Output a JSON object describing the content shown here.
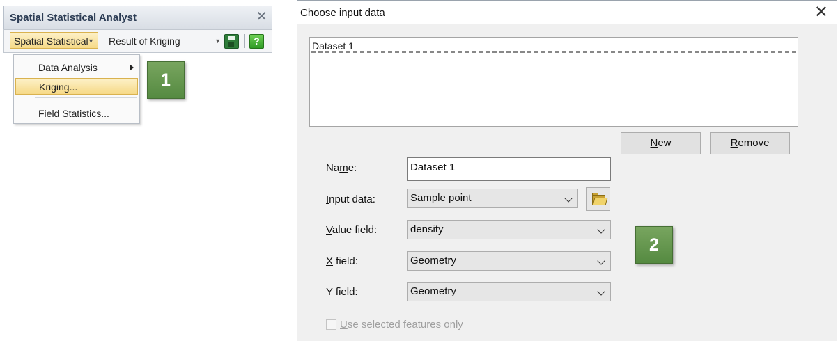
{
  "panel": {
    "title": "Spatial Statistical Analyst",
    "close_glyph": "✕",
    "toolbar": {
      "menu_button_label": "Spatial Statistical",
      "result_dropdown_value": "Result of Kriging",
      "save_icon": "save-icon",
      "help_icon": "help-icon",
      "help_glyph": "?"
    },
    "menu": {
      "items": [
        {
          "label": "Data Analysis",
          "has_submenu": true
        },
        {
          "label": "Kriging...",
          "highlighted": true
        },
        {
          "label": "Field Statistics..."
        }
      ]
    }
  },
  "badges": {
    "step1": "1",
    "step2": "2",
    "color": "#5f9349"
  },
  "dialog": {
    "title": "Choose input data",
    "close_glyph": "✕",
    "dataset_list": {
      "items": [
        "Dataset 1"
      ]
    },
    "buttons": {
      "new": {
        "accel": "N",
        "rest": "ew"
      },
      "remove": {
        "accel": "R",
        "rest": "emove"
      }
    },
    "name": {
      "pre": "Na",
      "accel": "m",
      "post": "e:",
      "value": "Dataset 1"
    },
    "input_data": {
      "accel": "I",
      "post": "nput data:",
      "value": "Sample point"
    },
    "value_field": {
      "accel": "V",
      "post": "alue field:",
      "value": "density"
    },
    "x_field": {
      "accel": "X",
      "post": " field:",
      "value": "Geometry"
    },
    "y_field": {
      "accel": "Y",
      "post": " field:",
      "value": "Geometry"
    },
    "use_selected": {
      "accel": "U",
      "post": "se selected features only",
      "checked": false,
      "disabled": true
    }
  },
  "colors": {
    "highlight": "#f6d987",
    "badge_green": "#5f9349",
    "dialog_bg": "#f0f0f0"
  }
}
